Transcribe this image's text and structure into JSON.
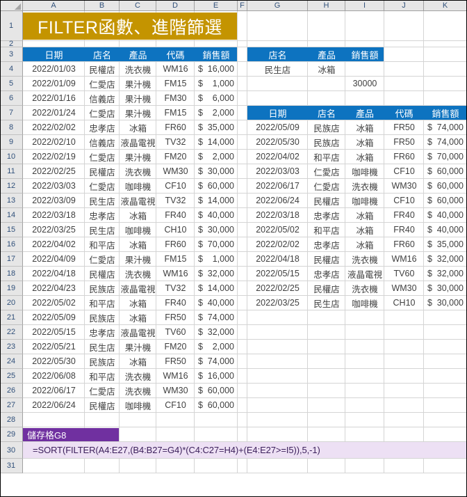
{
  "app": {
    "title_banner": "FILTER函數、進階篩選",
    "title_banner_color": "#C49400",
    "header_color": "#0D73C0",
    "label_color": "#7030A0",
    "formula_band_color": "#EDE0F4"
  },
  "columns": [
    "A",
    "B",
    "C",
    "D",
    "E",
    "F",
    "G",
    "H",
    "I",
    "J",
    "K"
  ],
  "rows": [
    1,
    2,
    3,
    4,
    5,
    6,
    7,
    8,
    9,
    10,
    11,
    12,
    13,
    14,
    15,
    16,
    17,
    18,
    19,
    20,
    21,
    22,
    23,
    24,
    25,
    26,
    27,
    28,
    29,
    30,
    31
  ],
  "source_table": {
    "headers": [
      "日期",
      "店名",
      "產品",
      "代碼",
      "銷售額"
    ],
    "rows": [
      [
        "2022/01/03",
        "民權店",
        "洗衣機",
        "WM16",
        "$",
        "16,000"
      ],
      [
        "2022/01/09",
        "仁愛店",
        "果汁機",
        "FM15",
        "$",
        "1,000"
      ],
      [
        "2022/01/16",
        "信義店",
        "果汁機",
        "FM30",
        "$",
        "6,000"
      ],
      [
        "2022/01/24",
        "仁愛店",
        "果汁機",
        "FM15",
        "$",
        "2,000"
      ],
      [
        "2022/02/02",
        "忠孝店",
        "冰箱",
        "FR60",
        "$",
        "35,000"
      ],
      [
        "2022/02/10",
        "信義店",
        "液晶電視",
        "TV32",
        "$",
        "14,000"
      ],
      [
        "2022/02/19",
        "仁愛店",
        "果汁機",
        "FM20",
        "$",
        "2,000"
      ],
      [
        "2022/02/25",
        "民權店",
        "洗衣機",
        "WM30",
        "$",
        "30,000"
      ],
      [
        "2022/03/03",
        "仁愛店",
        "咖啡機",
        "CF10",
        "$",
        "60,000"
      ],
      [
        "2022/03/09",
        "民生店",
        "液晶電視",
        "TV32",
        "$",
        "14,000"
      ],
      [
        "2022/03/18",
        "忠孝店",
        "冰箱",
        "FR40",
        "$",
        "40,000"
      ],
      [
        "2022/03/25",
        "民生店",
        "咖啡機",
        "CH10",
        "$",
        "30,000"
      ],
      [
        "2022/04/02",
        "和平店",
        "冰箱",
        "FR60",
        "$",
        "70,000"
      ],
      [
        "2022/04/09",
        "仁愛店",
        "果汁機",
        "FM15",
        "$",
        "1,000"
      ],
      [
        "2022/04/18",
        "民權店",
        "洗衣機",
        "WM16",
        "$",
        "32,000"
      ],
      [
        "2022/04/23",
        "民族店",
        "液晶電視",
        "TV32",
        "$",
        "14,000"
      ],
      [
        "2022/05/02",
        "和平店",
        "冰箱",
        "FR40",
        "$",
        "40,000"
      ],
      [
        "2022/05/09",
        "民族店",
        "冰箱",
        "FR50",
        "$",
        "74,000"
      ],
      [
        "2022/05/15",
        "忠孝店",
        "液晶電視",
        "TV60",
        "$",
        "32,000"
      ],
      [
        "2022/05/21",
        "民生店",
        "果汁機",
        "FM20",
        "$",
        "2,000"
      ],
      [
        "2022/05/30",
        "民族店",
        "冰箱",
        "FR50",
        "$",
        "74,000"
      ],
      [
        "2022/06/08",
        "和平店",
        "洗衣機",
        "WM16",
        "$",
        "16,000"
      ],
      [
        "2022/06/17",
        "仁愛店",
        "洗衣機",
        "WM30",
        "$",
        "60,000"
      ],
      [
        "2022/06/24",
        "民權店",
        "咖啡機",
        "CF10",
        "$",
        "60,000"
      ]
    ]
  },
  "criteria_table": {
    "headers": [
      "店名",
      "產品",
      "銷售額"
    ],
    "values": [
      "民生店",
      "冰箱",
      ""
    ],
    "threshold": "30000"
  },
  "result_table": {
    "headers": [
      "日期",
      "店名",
      "產品",
      "代碼",
      "銷售額"
    ],
    "rows": [
      [
        "2022/05/09",
        "民族店",
        "冰箱",
        "FR50",
        "$",
        "74,000"
      ],
      [
        "2022/05/30",
        "民族店",
        "冰箱",
        "FR50",
        "$",
        "74,000"
      ],
      [
        "2022/04/02",
        "和平店",
        "冰箱",
        "FR60",
        "$",
        "70,000"
      ],
      [
        "2022/03/03",
        "仁愛店",
        "咖啡機",
        "CF10",
        "$",
        "60,000"
      ],
      [
        "2022/06/17",
        "仁愛店",
        "洗衣機",
        "WM30",
        "$",
        "60,000"
      ],
      [
        "2022/06/24",
        "民權店",
        "咖啡機",
        "CF10",
        "$",
        "60,000"
      ],
      [
        "2022/03/18",
        "忠孝店",
        "冰箱",
        "FR40",
        "$",
        "40,000"
      ],
      [
        "2022/05/02",
        "和平店",
        "冰箱",
        "FR40",
        "$",
        "40,000"
      ],
      [
        "2022/02/02",
        "忠孝店",
        "冰箱",
        "FR60",
        "$",
        "35,000"
      ],
      [
        "2022/04/18",
        "民權店",
        "洗衣機",
        "WM16",
        "$",
        "32,000"
      ],
      [
        "2022/05/15",
        "忠孝店",
        "液晶電視",
        "TV60",
        "$",
        "32,000"
      ],
      [
        "2022/02/25",
        "民權店",
        "洗衣機",
        "WM30",
        "$",
        "30,000"
      ],
      [
        "2022/03/25",
        "民生店",
        "咖啡機",
        "CH10",
        "$",
        "30,000"
      ]
    ]
  },
  "formula_note": {
    "label": "儲存格G8",
    "formula": "=SORT(FILTER(A4:E27,(B4:B27=G4)*(C4:C27=H4)+(E4:E27>=I5)),5,-1)"
  }
}
